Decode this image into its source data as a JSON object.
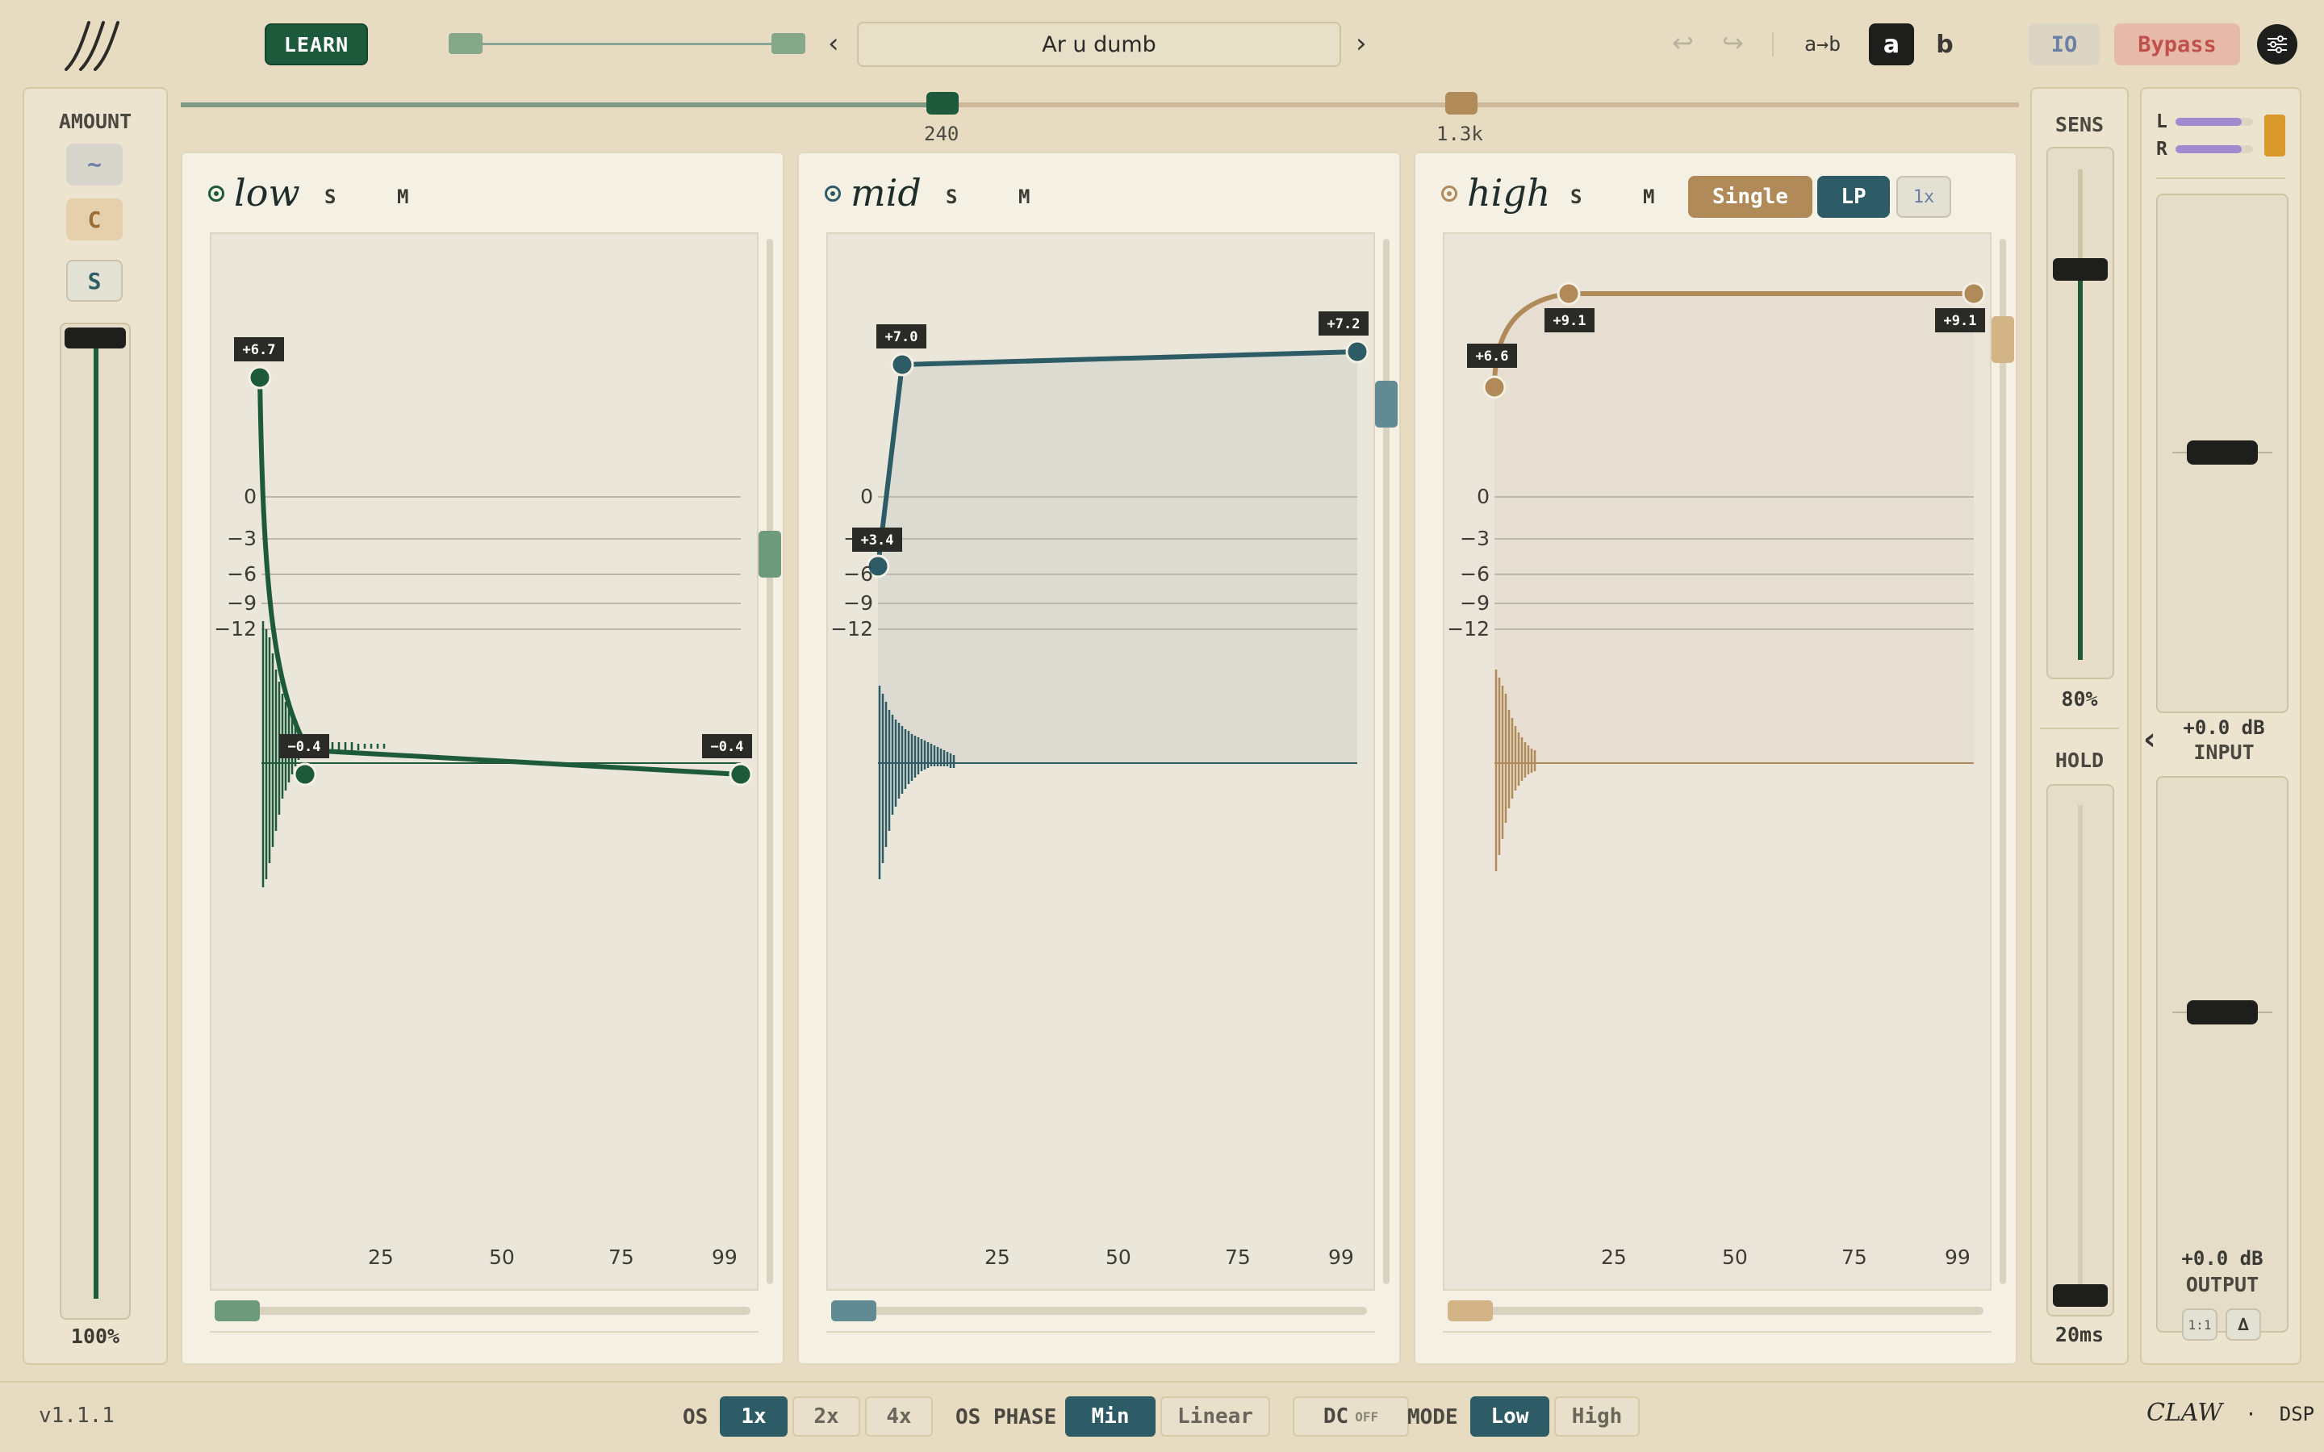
{
  "header": {
    "learn_label": "LEARN",
    "preset_prev": "‹",
    "preset_name": "Ar u dumb",
    "preset_next": "›",
    "undo_icon": "↩",
    "redo_icon": "↪",
    "ab_copy_label": "a→b",
    "a_label": "a",
    "b_label": "b",
    "io_label": "IO",
    "bypass_label": "Bypass"
  },
  "crossover": {
    "low_mid_value": "240",
    "mid_high_value": "1.3k"
  },
  "amount": {
    "title": "AMOUNT",
    "wave_btn": "~",
    "c_btn": "C",
    "s_btn": "S",
    "value": "100%",
    "level": 1.0
  },
  "bands": {
    "low": {
      "name": "low",
      "solo": "S",
      "mute": "M",
      "tags": [
        "+6.7",
        "−0.4",
        "−0.4"
      ],
      "y_labels": [
        "0",
        "−3",
        "−6",
        "−9",
        "−12"
      ],
      "x_labels": [
        "25",
        "50",
        "75",
        "99"
      ]
    },
    "mid": {
      "name": "mid",
      "solo": "S",
      "mute": "M",
      "tags": [
        "+7.0",
        "+7.2",
        "+3.4"
      ],
      "y_labels": [
        "0",
        "−3",
        "−6",
        "−9",
        "−12"
      ],
      "x_labels": [
        "25",
        "50",
        "75",
        "99"
      ]
    },
    "high": {
      "name": "high",
      "solo": "S",
      "mute": "M",
      "mode_single": "Single",
      "mode_lp": "LP",
      "mode_1x": "1x",
      "tags": [
        "+9.1",
        "+9.1",
        "+6.6"
      ],
      "y_labels": [
        "0",
        "−3",
        "−6",
        "−9",
        "−12"
      ],
      "x_labels": [
        "25",
        "50",
        "75",
        "99"
      ]
    }
  },
  "sens": {
    "title": "SENS",
    "value": "80%",
    "level": 0.8
  },
  "hold": {
    "title": "HOLD",
    "value": "20ms"
  },
  "io": {
    "l_label": "L",
    "r_label": "R",
    "collapse_icon": "‹",
    "input_value": "+0.0 dB",
    "input_label": "INPUT",
    "output_value": "+0.0 dB",
    "output_label": "OUTPUT",
    "ratio_btn": "1:1",
    "delta_btn": "∆"
  },
  "footer": {
    "version": "v1.1.1",
    "os_label": "OS",
    "os_options": [
      "1x",
      "2x",
      "4x"
    ],
    "os_phase_label": "OS PHASE",
    "phase_options": [
      "Min",
      "Linear"
    ],
    "dc_label": "DC",
    "dc_state": "OFF",
    "mode_label": "MODE",
    "mode_options": [
      "Low",
      "High"
    ],
    "brand": "CLAW",
    "brand_sep": "·",
    "brand_suffix": "DSP"
  },
  "colors": {
    "background": "#e7dcc2",
    "low": "#1d5a3c",
    "mid": "#2d5c66",
    "high": "#b08a58",
    "bypass_bg": "#e6b9a8",
    "bypass_fg": "#c0504a",
    "io_accent": "#a08ad0"
  }
}
